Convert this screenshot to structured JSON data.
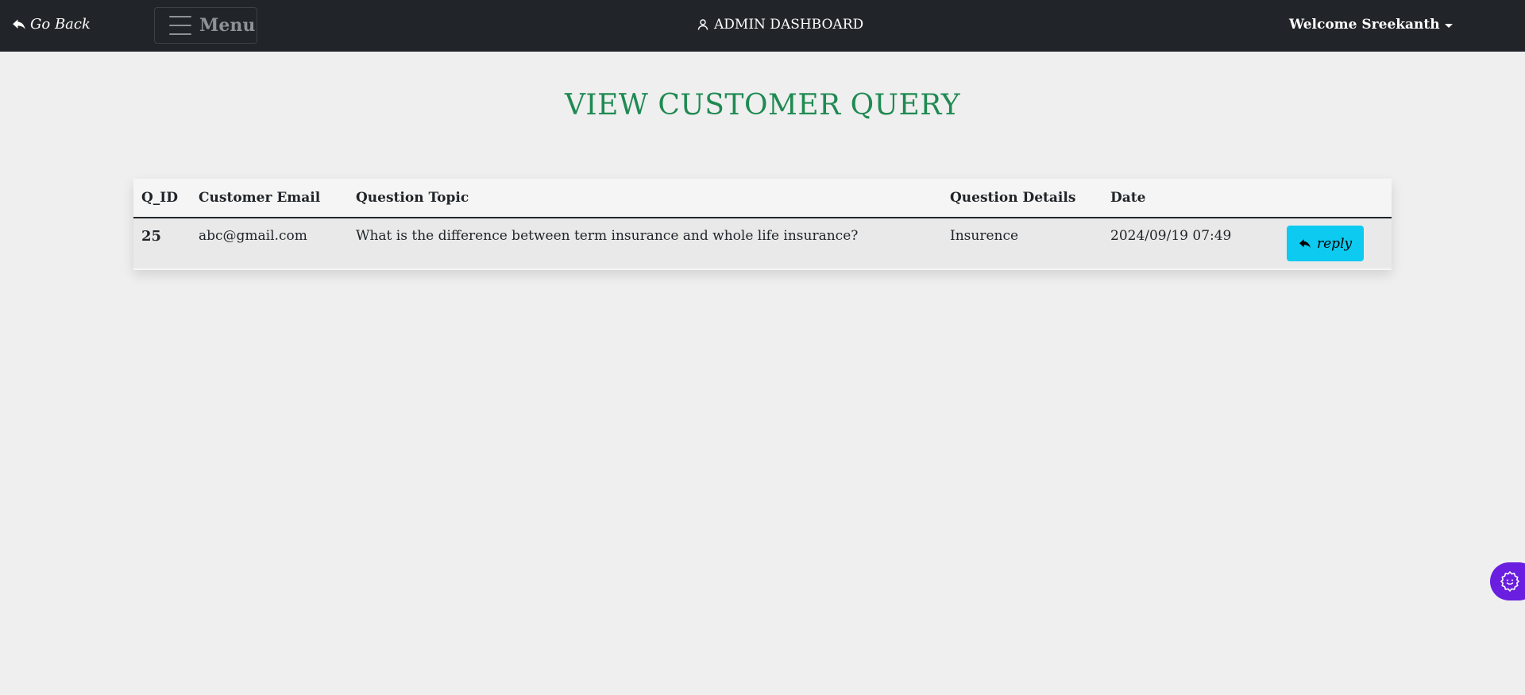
{
  "navbar": {
    "go_back_label": "Go Back",
    "menu_label": "Menu",
    "dashboard_title": "ADMIN DASHBOARD",
    "welcome_text": "Welcome Sreekanth"
  },
  "page": {
    "heading": "VIEW CUSTOMER QUERY"
  },
  "table": {
    "headers": {
      "qid": "Q_ID",
      "email": "Customer Email",
      "topic": "Question Topic",
      "details": "Question Details",
      "date": "Date"
    },
    "rows": [
      {
        "qid": "25",
        "email": "abc@gmail.com",
        "topic": "What is the difference between term insurance and whole life insurance?",
        "details": "Insurence",
        "date": "2024/09/19 07:49",
        "action_label": "reply"
      }
    ]
  },
  "icons": {
    "go_back": "reply-arrow-icon",
    "menu": "hamburger-icon",
    "dashboard": "user-icon",
    "welcome": "caret-down-icon",
    "reply": "reply-arrow-icon",
    "widget": "settings-gear-icon"
  },
  "colors": {
    "navbar_bg": "#212529",
    "heading": "#1f8a52",
    "reply_button": "#0dcaf0",
    "widget": "#6a1ee0"
  }
}
